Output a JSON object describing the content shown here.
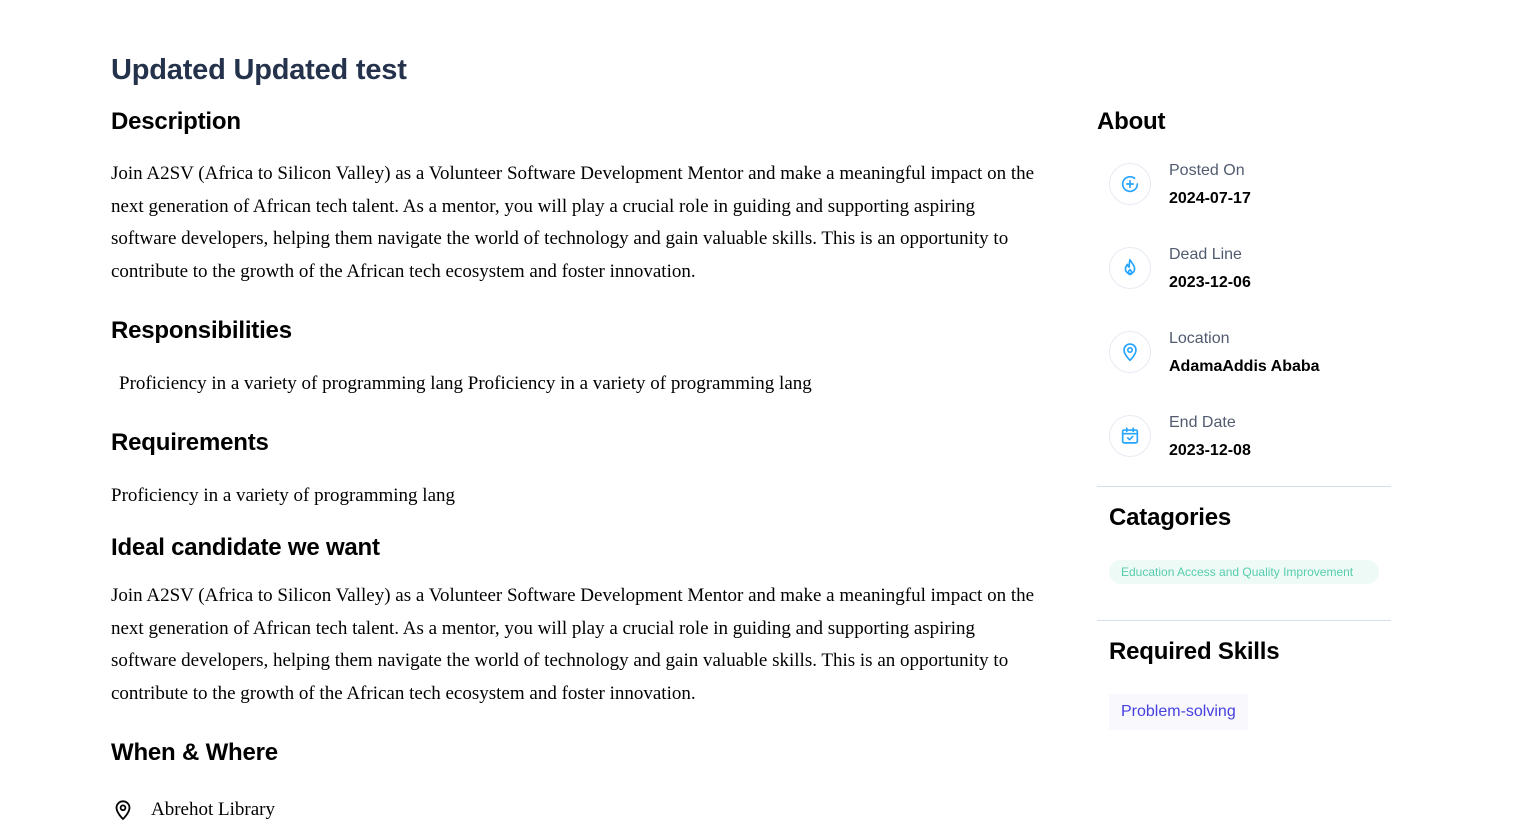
{
  "job": {
    "title": "Updated Updated test"
  },
  "description": {
    "heading": "Description",
    "text": "Join A2SV (Africa to Silicon Valley) as a Volunteer Software Development Mentor and make a meaningful impact on the next generation of African tech talent. As a mentor, you will play a crucial role in guiding and supporting aspiring software developers, helping them navigate the world of technology and gain valuable skills. This is an opportunity to contribute to the growth of the African tech ecosystem and foster innovation."
  },
  "responsibilities": {
    "heading": "Responsibilities",
    "text": "Proficiency in a variety of programming lang Proficiency in a variety of programming lang"
  },
  "requirements": {
    "heading": "Requirements",
    "text": "Proficiency in a variety of programming lang"
  },
  "ideal_candidate": {
    "heading": "Ideal candidate we want",
    "text": "Join A2SV (Africa to Silicon Valley) as a Volunteer Software Development Mentor and make a meaningful impact on the next generation of African tech talent. As a mentor, you will play a crucial role in guiding and supporting aspiring software developers, helping them navigate the world of technology and gain valuable skills. This is an opportunity to contribute to the growth of the African tech ecosystem and foster innovation."
  },
  "when_where": {
    "heading": "When & Where",
    "location": "Abrehot Library",
    "icon": "location-pin-icon"
  },
  "about": {
    "heading": "About",
    "items": [
      {
        "label": "Posted On",
        "value": "2024-07-17",
        "icon": "plus-circle-icon"
      },
      {
        "label": "Dead Line",
        "value": "2023-12-06",
        "icon": "fire-icon"
      },
      {
        "label": "Location",
        "value": "AdamaAddis Ababa",
        "icon": "location-pin-icon"
      },
      {
        "label": "End Date",
        "value": "2023-12-08",
        "icon": "calendar-check-icon"
      }
    ]
  },
  "categories": {
    "heading": "Catagories",
    "items": [
      "Education Access and Quality Improvement"
    ]
  },
  "required_skills": {
    "heading": "Required Skills",
    "items": [
      "Problem-solving"
    ]
  },
  "colors": {
    "title": "#25324b",
    "icon_accent": "#26a4ff",
    "category_text": "#56cdad",
    "category_bg": "#eefaf6",
    "skill_text": "#4640de",
    "skill_bg": "#f8f8fd"
  }
}
